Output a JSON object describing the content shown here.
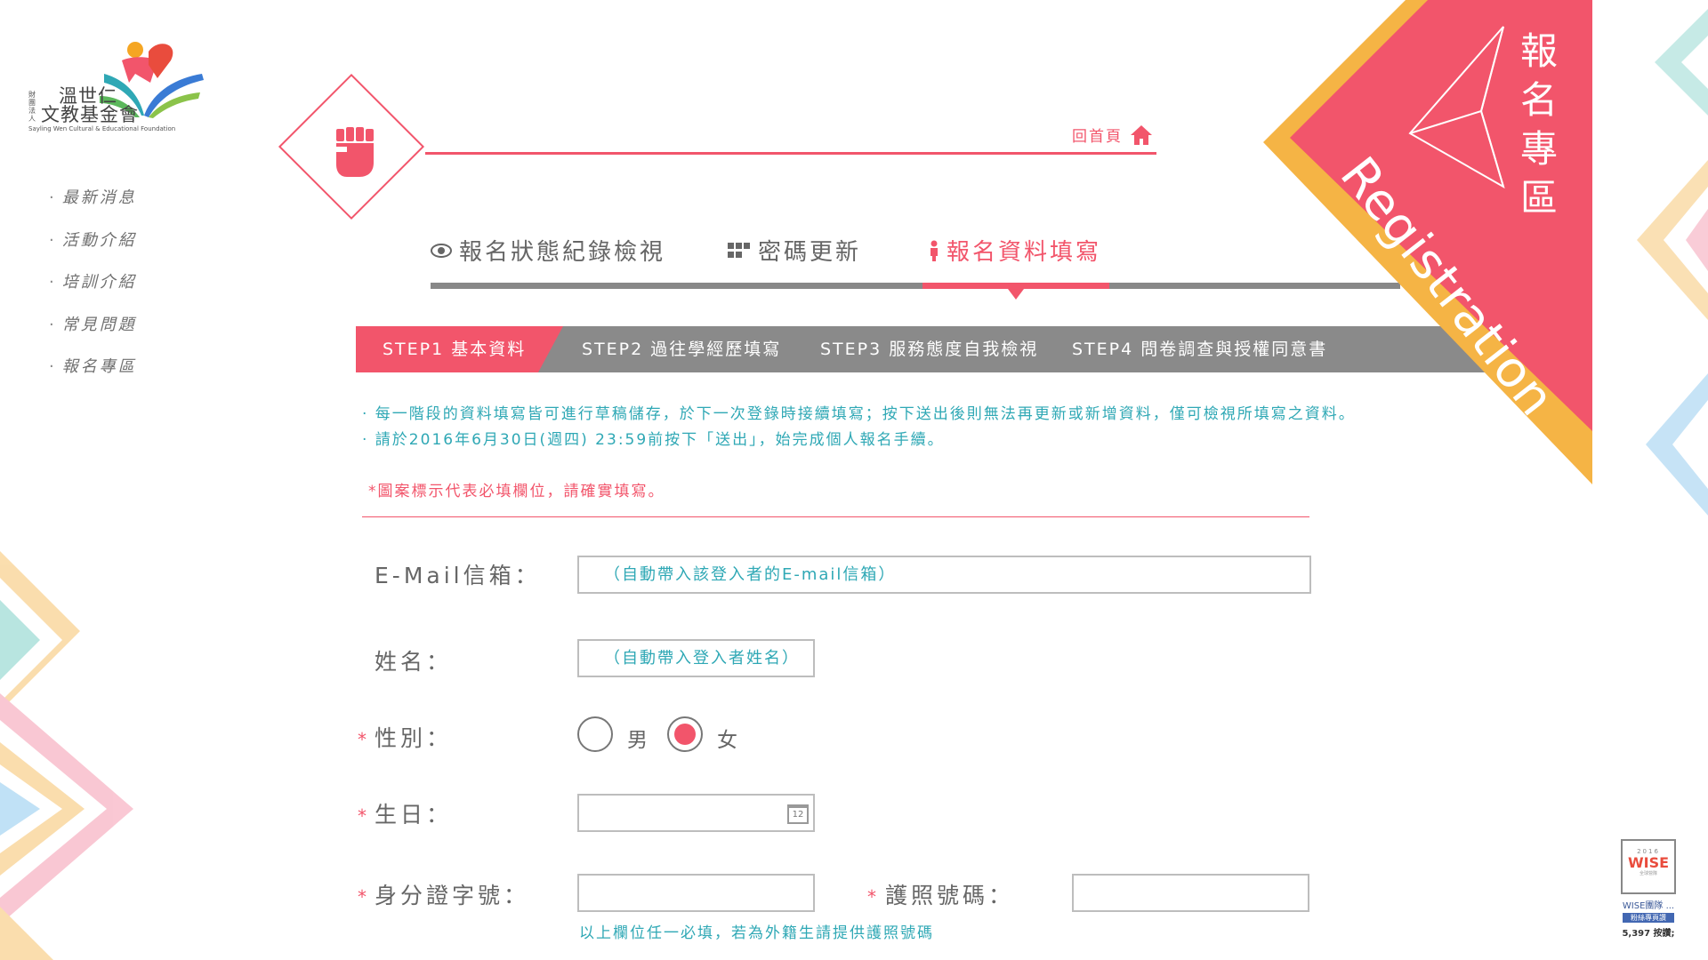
{
  "colors": {
    "accent": "#f2556b",
    "teal": "#2fa8b5",
    "gold": "#f5b445",
    "gray": "#8a8a8a"
  },
  "logo": {
    "small": "財團法人",
    "name_line1": "溫世仁",
    "name_line2": "文教基金會",
    "en": "Sayling Wen Cultural & Educational Foundation"
  },
  "sidenav": {
    "items": [
      {
        "label": "最新消息"
      },
      {
        "label": "活動介紹"
      },
      {
        "label": "培訓介紹"
      },
      {
        "label": "常見問題"
      },
      {
        "label": "報名專區"
      }
    ]
  },
  "header": {
    "home_label": "回首頁",
    "home_icon": "home-icon",
    "section_icon": "fist-icon"
  },
  "tabs": [
    {
      "label": "報名狀態紀錄檢視",
      "icon": "eye-icon"
    },
    {
      "label": "密碼更新",
      "icon": "grid-icon"
    },
    {
      "label": "報名資料填寫",
      "icon": "person-icon",
      "active": true
    }
  ],
  "steps": [
    {
      "label": "STEP1 基本資料",
      "active": true
    },
    {
      "label": "STEP2 過往學經歷填寫"
    },
    {
      "label": "STEP3 服務態度自我檢視"
    },
    {
      "label": "STEP4 問卷調查與授權同意書"
    }
  ],
  "notes": [
    "· 每一階段的資料填寫皆可進行草稿儲存，於下一次登錄時接續填寫；按下送出後則無法再更新或新增資料，僅可檢視所填寫之資料。",
    "· 請於2016年6月30日(週四) 23:59前按下「送出」，始完成個人報名手續。"
  ],
  "required_note": "*圖案標示代表必填欄位，請確實填寫。",
  "form": {
    "email": {
      "label": "E-Mail信箱：",
      "value": "（自動帶入該登入者的E-mail信箱）"
    },
    "name": {
      "label": "姓名：",
      "value": "（自動帶入登入者姓名）"
    },
    "gender": {
      "label": "性別：",
      "options": [
        "男",
        "女"
      ],
      "selected": "女"
    },
    "birthday": {
      "label": "生日：",
      "value": "",
      "calendar_text": "12"
    },
    "id_number": {
      "label": "身分證字號：",
      "value": ""
    },
    "passport": {
      "label": "護照號碼：",
      "value": ""
    },
    "hint": "以上欄位任一必填，若為外籍生請提供護照號碼",
    "required_mark": "*"
  },
  "banner": {
    "title": [
      "報",
      "名",
      "專",
      "區"
    ],
    "en": "Registration"
  },
  "widget": {
    "year": "2016",
    "logo": "WISE",
    "sub": "全球營隊",
    "name": "WISE團隊 ...",
    "fb_label": "粉絲專頁讚",
    "likes": "5,397 按讚;"
  }
}
